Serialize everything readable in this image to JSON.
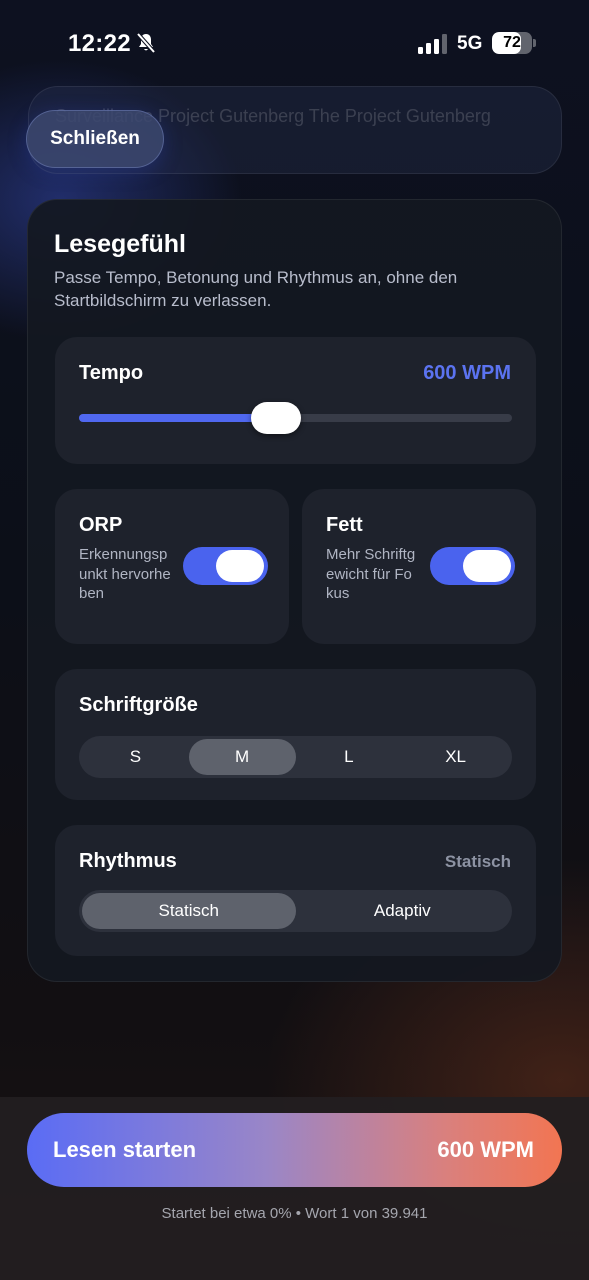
{
  "status_bar": {
    "time": "12:22",
    "network": "5G",
    "battery": "72",
    "battery_level": 0.72,
    "signal_bars_active": 3,
    "signal_bars_total": 4,
    "icons": [
      "bell-slash-icon",
      "signal-icon",
      "battery-icon"
    ]
  },
  "header": {
    "book_title": "Surveillance Project Gutenberg The Project Gutenberg eBook of",
    "close_label": "Schließen"
  },
  "panel": {
    "title": "Lesegefühl",
    "subtitle": "Passe Tempo, Betonung und Rhythmus an, ohne den Startbildschirm zu verlassen."
  },
  "tempo": {
    "label": "Tempo",
    "value_text": "600 WPM",
    "slider_fraction": 0.455
  },
  "orp": {
    "title": "ORP",
    "description": "Erkennungspunkt hervorheben",
    "enabled": true
  },
  "fett": {
    "title": "Fett",
    "description": "Mehr Schriftgewicht für Fokus",
    "enabled": true
  },
  "font_size": {
    "label": "Schriftgröße",
    "options": [
      "S",
      "M",
      "L",
      "XL"
    ],
    "selected": "M"
  },
  "rhythm": {
    "label": "Rhythmus",
    "current_value": "Statisch",
    "options": [
      "Statisch",
      "Adaptiv"
    ],
    "selected": "Statisch"
  },
  "start": {
    "label": "Lesen starten",
    "wpm": "600 WPM",
    "footnote": "Startet bei etwa 0% • Wort 1 von 39.941"
  },
  "colors": {
    "accent": "#5068f0",
    "gradient_start": "#5a6cf5",
    "gradient_end": "#f27552"
  }
}
